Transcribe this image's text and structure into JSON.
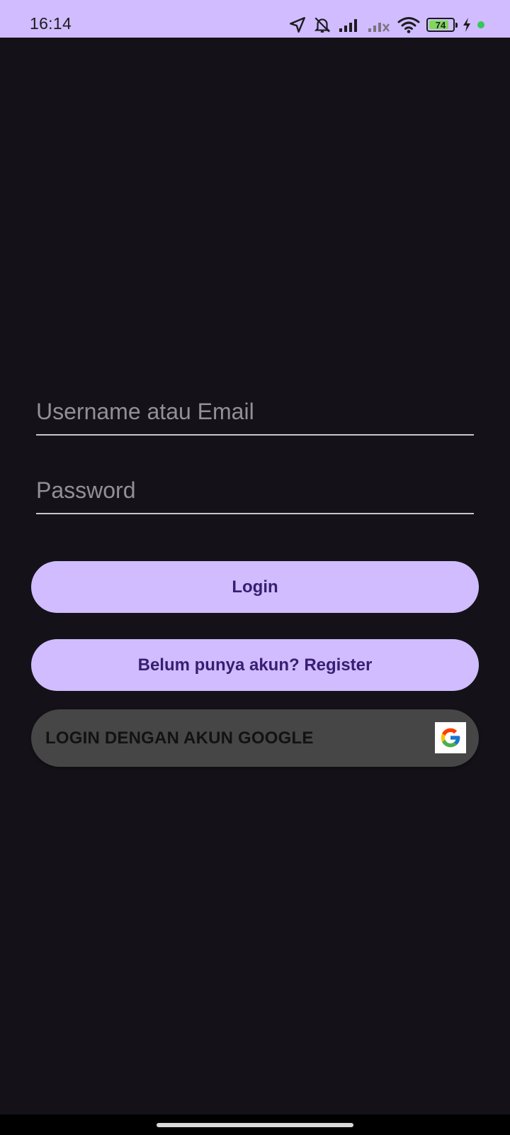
{
  "status_bar": {
    "time": "16:14",
    "battery_level": "74",
    "icons": [
      "location-arrow-icon",
      "bell-muted-icon",
      "signal-icon",
      "signal-no-service-icon",
      "wifi-icon",
      "battery-icon",
      "charging-bolt-icon",
      "privacy-dot-icon"
    ],
    "background_color": "#d0bcff"
  },
  "login_form": {
    "username_placeholder": "Username atau Email",
    "username_value": "",
    "password_placeholder": "Password",
    "password_value": "",
    "login_label": "Login",
    "register_label": "Belum punya akun? Register",
    "google_label": "LOGIN DENGAN AKUN GOOGLE",
    "google_icon": "google-g-icon"
  },
  "colors": {
    "background": "#141218",
    "primary_button": "#d0bcff",
    "primary_button_text": "#381e72",
    "google_button": "#464646"
  }
}
